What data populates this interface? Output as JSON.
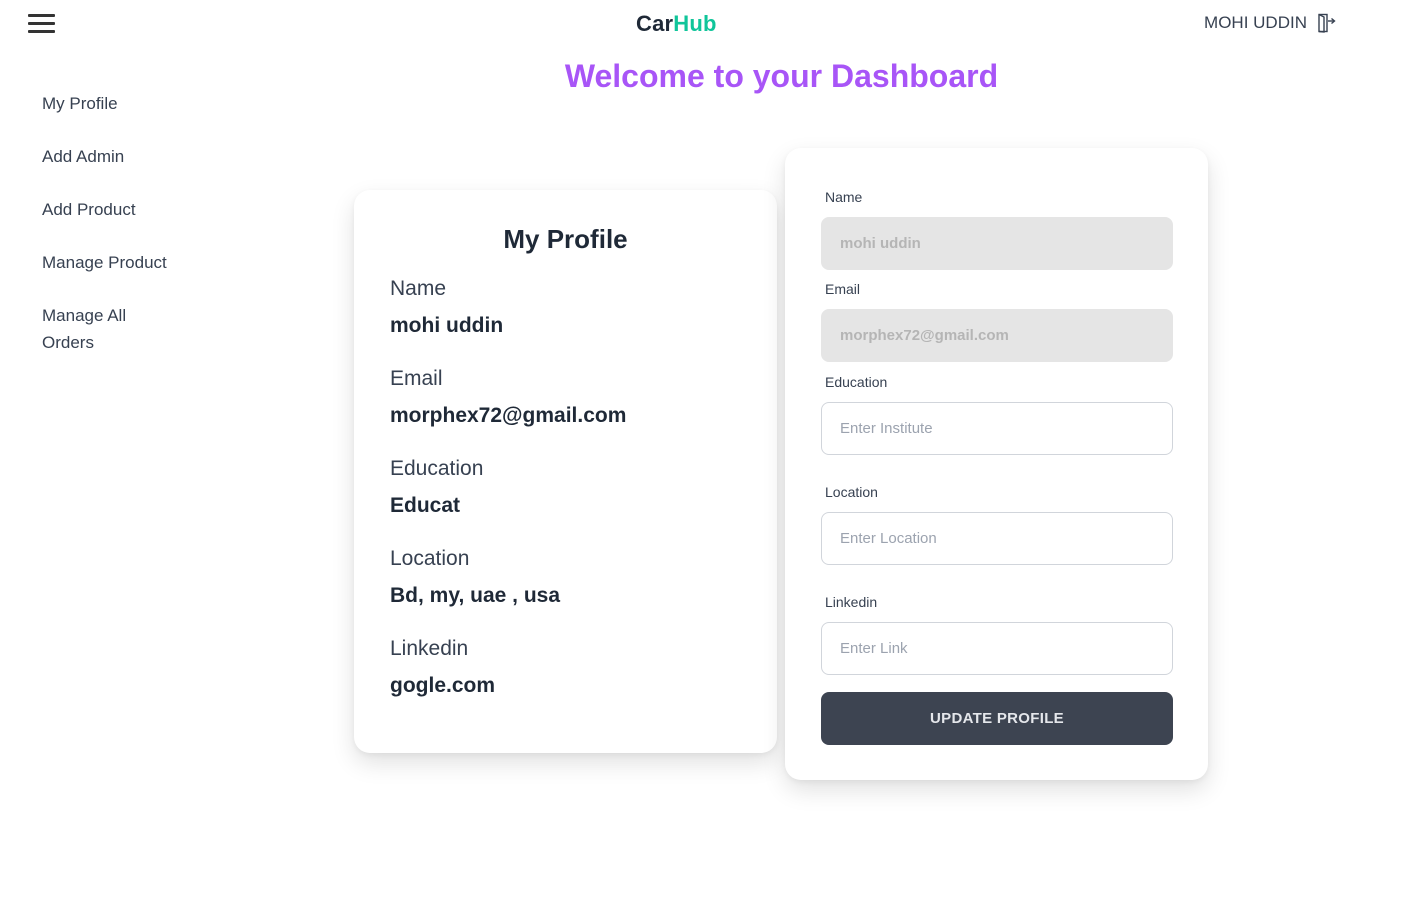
{
  "header": {
    "brand_part1": "Car",
    "brand_part2": "Hub",
    "user_name": "MOHI UDDIN"
  },
  "sidebar": {
    "items": [
      {
        "label": "My Profile"
      },
      {
        "label": "Add Admin"
      },
      {
        "label": "Add Product"
      },
      {
        "label": "Manage Product"
      },
      {
        "label": "Manage All Orders"
      }
    ]
  },
  "main": {
    "welcome": "Welcome to your Dashboard"
  },
  "profile": {
    "title": "My Profile",
    "fields": [
      {
        "label": "Name",
        "value": "mohi uddin"
      },
      {
        "label": "Email",
        "value": "morphex72@gmail.com"
      },
      {
        "label": "Education",
        "value": "Educat"
      },
      {
        "label": "Location",
        "value": "Bd, my, uae , usa"
      },
      {
        "label": "Linkedin",
        "value": "gogle.com"
      }
    ]
  },
  "form": {
    "name_label": "Name",
    "name_value": "mohi uddin",
    "email_label": "Email",
    "email_value": "morphex72@gmail.com",
    "education_label": "Education",
    "education_placeholder": "Enter Institute",
    "location_label": "Location",
    "location_placeholder": "Enter Location",
    "linkedin_label": "Linkedin",
    "linkedin_placeholder": "Enter Link",
    "submit_label": "UPDATE PROFILE"
  },
  "colors": {
    "accent_purple": "#a855f7",
    "brand_green": "#10c59a",
    "button_dark": "#3d4451"
  },
  "icons": [
    "menu-icon",
    "logout-icon"
  ]
}
